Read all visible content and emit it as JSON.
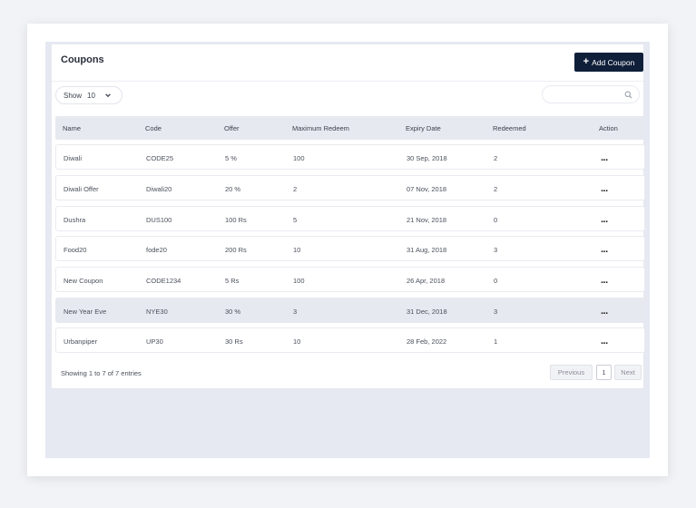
{
  "page": {
    "title": "Coupons",
    "add_button_label": "Add Coupon"
  },
  "controls": {
    "show_label": "Show",
    "show_value": "10",
    "search_placeholder": ""
  },
  "table": {
    "headers": [
      "Name",
      "Code",
      "Offer",
      "Maximum Redeem",
      "Expiry Date",
      "Redeemed",
      "Action"
    ],
    "rows": [
      {
        "name": "Diwali",
        "code": "CODE25",
        "offer": "5 %",
        "max": "100",
        "expiry": "30 Sep, 2018",
        "redeemed": "2"
      },
      {
        "name": "Diwali Offer",
        "code": "Diwali20",
        "offer": "20 %",
        "max": "2",
        "expiry": "07 Nov, 2018",
        "redeemed": "2"
      },
      {
        "name": "Dushra",
        "code": "DUS100",
        "offer": "100 Rs",
        "max": "5",
        "expiry": "21 Nov, 2018",
        "redeemed": "0"
      },
      {
        "name": "Food20",
        "code": "fode20",
        "offer": "200 Rs",
        "max": "10",
        "expiry": "31 Aug, 2018",
        "redeemed": "3"
      },
      {
        "name": "New Coupon",
        "code": "CODE1234",
        "offer": "5 Rs",
        "max": "100",
        "expiry": "26 Apr, 2018",
        "redeemed": "0"
      },
      {
        "name": "New Year Eve",
        "code": "NYE30",
        "offer": "30 %",
        "max": "3",
        "expiry": "31 Dec, 2018",
        "redeemed": "3"
      },
      {
        "name": "Urbanpiper",
        "code": "UP30",
        "offer": "30 Rs",
        "max": "10",
        "expiry": "28 Feb, 2022",
        "redeemed": "1"
      }
    ],
    "action_label": "..."
  },
  "footer": {
    "entries_text": "Showing 1 to 7 of 7 entries",
    "previous_label": "Previous",
    "current_page": "1",
    "next_label": "Next"
  },
  "colors": {
    "accent": "#0f1f3a",
    "stage": "#e6e8f2",
    "highlight_row": "#e7e9f0"
  },
  "icons": {
    "show_dropdown": "chevron-down-icon",
    "search": "search-icon",
    "add": "plus-icon",
    "action": "more-horizontal-icon"
  }
}
